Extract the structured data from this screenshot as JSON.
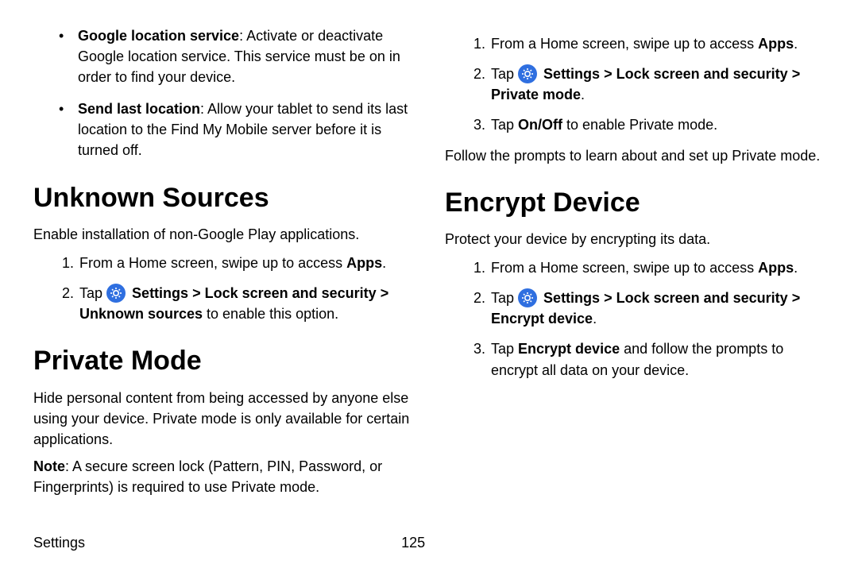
{
  "left": {
    "bullets": [
      {
        "label": "Google location service",
        "rest": ": Activate or deactivate Google location service. This service must be on in order to find your device."
      },
      {
        "label": "Send last location",
        "rest": ": Allow your tablet to send its last location to the Find My Mobile server before it is turned off."
      }
    ],
    "section1": {
      "title": "Unknown Sources",
      "intro": "Enable installation of non-Google Play applications.",
      "step1a": "From a Home screen, swipe up to access ",
      "step1b": "Apps",
      "step1c": ".",
      "step2_tap": "Tap ",
      "step2_settings": "Settings",
      "step2_gt1": " > ",
      "step2_lock": "Lock screen and security",
      "step2_gt2": " > ",
      "step2_target": "Unknown sources",
      "step2_rest": " to enable this option."
    },
    "section2": {
      "title": "Private Mode",
      "intro": "Hide personal content from being accessed by anyone else using your device. Private mode is only available for certain applications.",
      "note_label": "Note",
      "note_rest": ": A secure screen lock (Pattern, PIN, Password, or Fingerprints) is required to use Private mode."
    }
  },
  "right": {
    "step1a": "From a Home screen, swipe up to access ",
    "step1b": "Apps",
    "step1c": ".",
    "step2_tap": "Tap ",
    "step2_settings": "Settings",
    "step2_gt1": " > ",
    "step2_lock": "Lock screen and security",
    "step2_gt2": " > ",
    "step2_target": "Private mode",
    "step2_rest": ".",
    "step3a": "Tap ",
    "step3b": "On/Off",
    "step3c": " to enable Private mode.",
    "follow": "Follow the prompts to learn about and set up Private mode.",
    "section": {
      "title": "Encrypt Device",
      "intro": "Protect your device by encrypting its data.",
      "s1a": "From a Home screen, swipe up to access ",
      "s1b": "Apps",
      "s1c": ".",
      "s2_tap": "Tap ",
      "s2_settings": "Settings",
      "s2_gt1": " > ",
      "s2_lock": "Lock screen and security",
      "s2_gt2": " > ",
      "s2_target": "Encrypt device",
      "s2_rest": ".",
      "s3a": "Tap ",
      "s3b": "Encrypt device",
      "s3c": " and follow the prompts to encrypt all data on your device."
    }
  },
  "footer": {
    "label": "Settings",
    "page": "125"
  }
}
